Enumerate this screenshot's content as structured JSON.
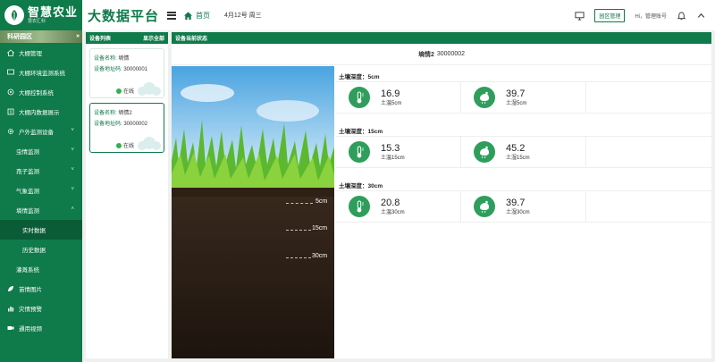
{
  "brand": {
    "name": "智慧农业",
    "sub": "慧农汇科",
    "platform": "大数据平台"
  },
  "header": {
    "home": "首页",
    "date": "4月12号 周三",
    "park_manage": "园区管理",
    "greeting": "Hi，管理账号"
  },
  "sidebar": {
    "park": "科研园区",
    "items": [
      {
        "label": "大棚管理",
        "icon": "house-icon"
      },
      {
        "label": "大棚环境监测系统",
        "icon": "monitor-icon"
      },
      {
        "label": "大棚控制系统",
        "icon": "control-icon"
      },
      {
        "label": "大棚内数据展示",
        "icon": "data-icon"
      },
      {
        "label": "户外监测设备",
        "icon": "gear-icon",
        "caret": "˅"
      },
      {
        "label": "虫情监测",
        "caret": "˅"
      },
      {
        "label": "孢子监测",
        "caret": "˅"
      },
      {
        "label": "气象监测",
        "caret": "˅"
      },
      {
        "label": "墒情监测",
        "caret": "˄"
      },
      {
        "label": "实时数据"
      },
      {
        "label": "历史数据"
      },
      {
        "label": "灌溉系统"
      },
      {
        "label": "苗情图片",
        "icon": "leaf-icon"
      },
      {
        "label": "灾情预警",
        "icon": "chart-icon"
      },
      {
        "label": "通用视频",
        "icon": "video-icon"
      }
    ]
  },
  "devlist": {
    "title": "设备列表",
    "show_all": "显示全部",
    "devices": [
      {
        "name_label": "设备名称:",
        "name": "墒情",
        "addr_label": "设备地址码:",
        "addr": "30000001",
        "status": "在线"
      },
      {
        "name_label": "设备名称:",
        "name": "墒情2",
        "addr_label": "设备地址码:",
        "addr": "30000002",
        "status": "在线"
      }
    ]
  },
  "status": {
    "title": "设备当前状态",
    "device_name": "墒情2",
    "device_code": "30000002",
    "depth_marks": [
      "5cm",
      "15cm",
      "30cm"
    ],
    "groups": [
      {
        "head": "土壤深度：5cm",
        "temp": {
          "value": "16.9",
          "label": "土温5cm"
        },
        "hum": {
          "value": "39.7",
          "label": "土湿5cm"
        }
      },
      {
        "head": "土壤深度：15cm",
        "temp": {
          "value": "15.3",
          "label": "土温15cm"
        },
        "hum": {
          "value": "45.2",
          "label": "土湿15cm"
        }
      },
      {
        "head": "土壤深度：30cm",
        "temp": {
          "value": "20.8",
          "label": "土温30cm"
        },
        "hum": {
          "value": "39.7",
          "label": "土湿30cm"
        }
      }
    ]
  },
  "colors": {
    "primary": "#0f7a4a",
    "badge": "#2f9e5c",
    "online": "#35b050"
  }
}
